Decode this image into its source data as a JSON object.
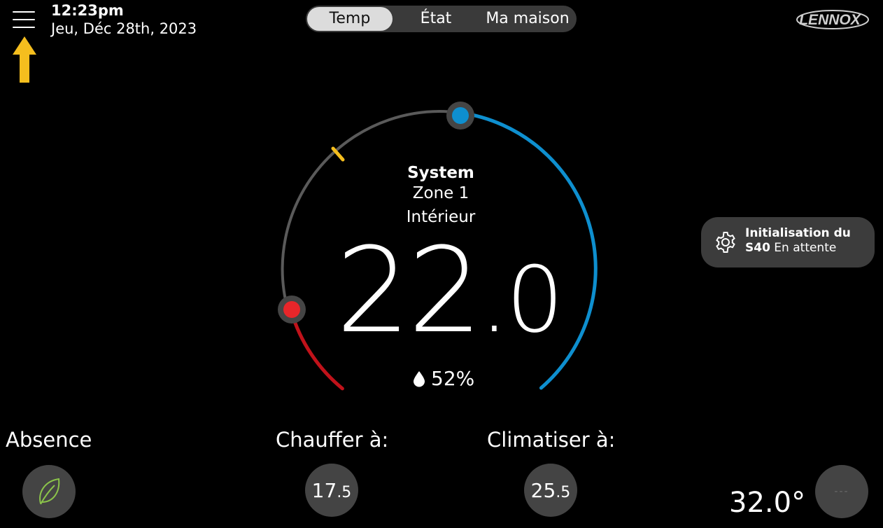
{
  "header": {
    "time": "12:23pm",
    "date": "Jeu, Déc 28th, 2023",
    "menu_icon": "hamburger-menu-icon",
    "arrow_icon": "arrow-up-icon",
    "arrow_color": "#F5BE1E",
    "tabs": [
      {
        "label": "Temp",
        "active": true
      },
      {
        "label": "État",
        "active": false
      },
      {
        "label": "Ma maison",
        "active": false
      }
    ],
    "logo_text": "LENNOX"
  },
  "dial": {
    "title": "System",
    "zone": "Zone 1",
    "location": "Intérieur",
    "temp_whole": "22",
    "temp_decimal": ".0",
    "humidity": "52%",
    "humidity_icon": "water-drop-icon",
    "heat_color": "#C0121A",
    "cool_color": "#0E8FCF",
    "marker_color": "#F5BE1E"
  },
  "notice": {
    "icon": "gear-icon",
    "line1_bold": "Initialisation du",
    "line2_bold": "S40",
    "line2_rest": " En attente"
  },
  "bottom": {
    "away_label": "Absence",
    "away_icon": "leaf-icon",
    "heat_label": "Chauffer à:",
    "heat_whole": "17",
    "heat_decimal": ".5",
    "cool_label": "Climatiser à:",
    "cool_whole": "25",
    "cool_decimal": ".5",
    "outdoor_temp": "32.0°",
    "fan_value": "---"
  }
}
